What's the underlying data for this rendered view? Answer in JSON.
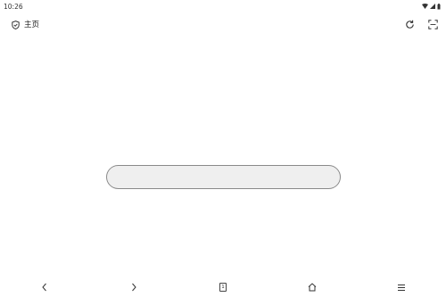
{
  "status_bar": {
    "time": "10:26",
    "icons": [
      "wifi-icon",
      "signal-icon",
      "battery-icon"
    ]
  },
  "toolbar": {
    "home_label": "主页",
    "home_icon": "shield-icon",
    "refresh_icon": "refresh-icon",
    "scan_icon": "scan-icon"
  },
  "search": {
    "value": "",
    "placeholder": ""
  },
  "bottom_nav": {
    "back_icon": "chevron-left-icon",
    "forward_icon": "chevron-right-icon",
    "tabs_count": "1",
    "home_icon": "home-icon",
    "menu_icon": "menu-icon"
  },
  "colors": {
    "background": "#ffffff",
    "search_fill": "#efefef",
    "search_border": "#8a8a8a",
    "icon": "#333333"
  }
}
